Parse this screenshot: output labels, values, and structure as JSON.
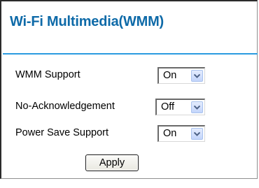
{
  "title": "Wi-Fi Multimedia(WMM)",
  "settings": [
    {
      "label": "WMM Support",
      "value": "On"
    },
    {
      "label": "No-Acknowledgement",
      "value": "Off"
    },
    {
      "label": "Power Save Support",
      "value": "On"
    }
  ],
  "apply_label": "Apply",
  "colors": {
    "title": "#0e6aa8",
    "rule": "#2b9be0",
    "dropdown_arrow": "#4d6185"
  }
}
